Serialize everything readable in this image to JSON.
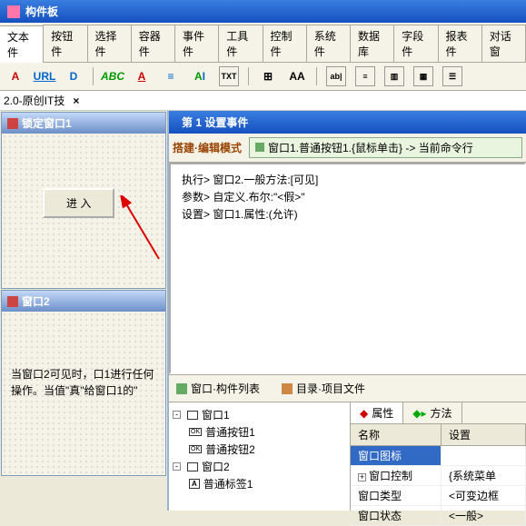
{
  "palette": {
    "title": "构件板",
    "tabs": [
      "文本件",
      "按钮件",
      "选择件",
      "容器件",
      "事件件",
      "工具件",
      "控制件",
      "系统件",
      "数据库",
      "字段件",
      "报表件",
      "对话窗"
    ],
    "active_tab": 0
  },
  "breadcrumb": {
    "text": "2.0-原创IT技",
    "close": "×"
  },
  "left_panels": {
    "panel1": {
      "title": "锁定窗口1",
      "button": "进 入"
    },
    "panel2": {
      "title": "窗口2",
      "hint": "当窗口2可见时，口1进行任何操作。当值\"真\"给窗口1的\""
    }
  },
  "event_window": {
    "title": "第 1 设置事件",
    "mode_label": "搭建·编辑模式",
    "path": "窗口1.普通按钮1.{鼠标单击} -> 当前命令行",
    "script": {
      "l1": "执行> 窗口2.一般方法:[可见]",
      "l2": "参数> 自定义.布尔:\"<假>\"",
      "l3": "设置> 窗口1.属性:(允许)"
    }
  },
  "bottom": {
    "tabs": {
      "t1": "窗口·构件列表",
      "t2": "目录·项目文件"
    },
    "tree": {
      "n1": "窗口1",
      "n1a": "普通按钮1",
      "n1b": "普通按钮2",
      "n2": "窗口2",
      "n2a": "普通标签1"
    },
    "prop_tabs": {
      "p1": "属性",
      "p2": "方法"
    },
    "prop_headers": {
      "h1": "名称",
      "h2": "设置"
    },
    "prop_rows": {
      "r1n": "窗口图标",
      "r1v": "",
      "r2n": "窗口控制",
      "r2v": "{系统菜单",
      "r3n": "窗口类型",
      "r3v": "<可变边框",
      "r4n": "窗口状态",
      "r4v": "<一般>"
    }
  }
}
